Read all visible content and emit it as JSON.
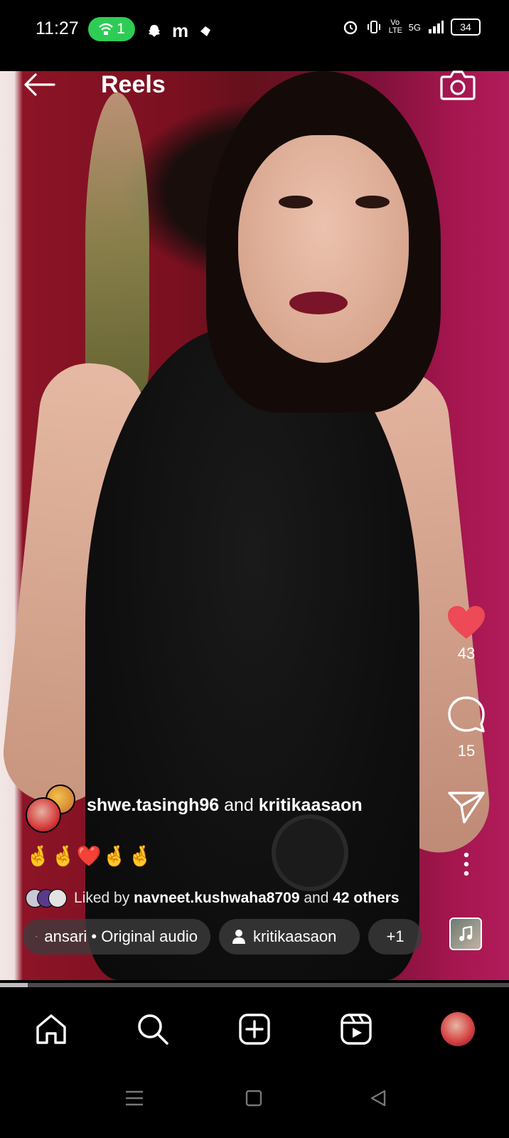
{
  "status_bar": {
    "time": "11:27",
    "wifi_count": "1",
    "battery": "34",
    "network": "5G",
    "volte": "Vo\nLTE"
  },
  "header": {
    "title": "Reels",
    "back_icon": "arrow-left-icon",
    "camera_icon": "camera-icon"
  },
  "actions": {
    "likes": "43",
    "comments": "15",
    "like_color": "#ed4956"
  },
  "post": {
    "user1": "shwe.tasingh96",
    "connector": " and ",
    "user2": "kritikaasaon",
    "emojis": "🤞🤞❤️🤞🤞",
    "liked_prefix": "Liked by ",
    "liked_user": "navneet.kushwaha8709",
    "liked_connector": " and ",
    "liked_others": "42 others"
  },
  "chips": {
    "audio": "ansari • Original audio",
    "tagged_user": "kritikaasaon",
    "more": "+1"
  },
  "progress": {
    "fraction": 0.055
  }
}
